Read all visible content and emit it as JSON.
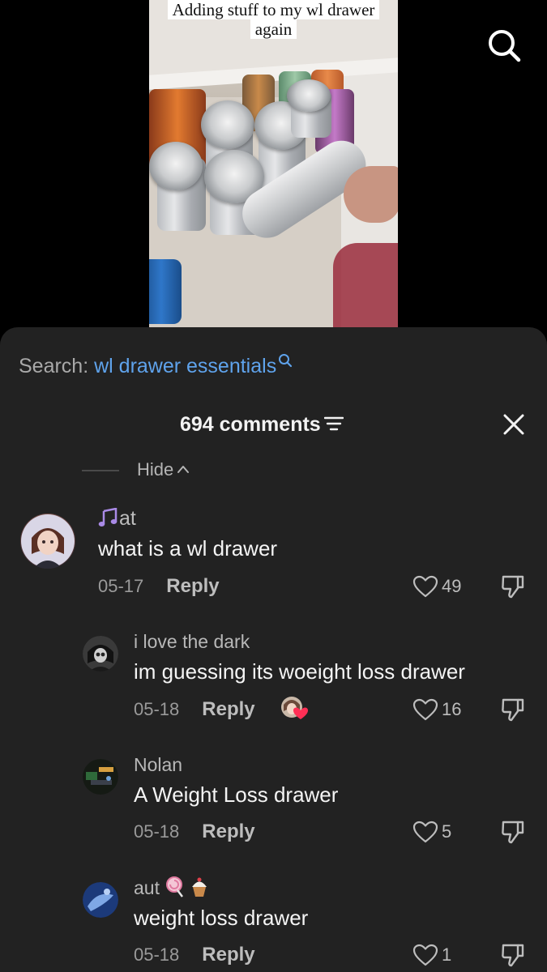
{
  "video": {
    "caption": "Adding stuff to my wl drawer again"
  },
  "search": {
    "label": "Search: ",
    "term": "wl drawer essentials"
  },
  "comments_header": {
    "count_label": "694 comments"
  },
  "hide_label": "Hide",
  "comments": [
    {
      "username": "at",
      "username_prefix_icon": "music-note-icon",
      "text": "what is a wl drawer",
      "date": "05-17",
      "reply_label": "Reply",
      "likes": "49"
    },
    {
      "username": "i love the dark",
      "text": "im guessing its woeight loss drawer",
      "date": "05-18",
      "reply_label": "Reply",
      "likes": "16",
      "liked_by_creator": true
    },
    {
      "username": "Nolan",
      "text": "A Weight Loss drawer",
      "date": "05-18",
      "reply_label": "Reply",
      "likes": "5"
    },
    {
      "username": "aut",
      "username_suffix_icons": [
        "lollipop-icon",
        "cupcake-icon"
      ],
      "text": "weight loss drawer",
      "date": "05-18",
      "reply_label": "Reply",
      "likes": "1"
    }
  ],
  "colors": {
    "sheet_background": "#222222",
    "search_term": "#5fa3ec",
    "music_note": "#a98ae6",
    "heart_badge": "#ff2f55"
  }
}
